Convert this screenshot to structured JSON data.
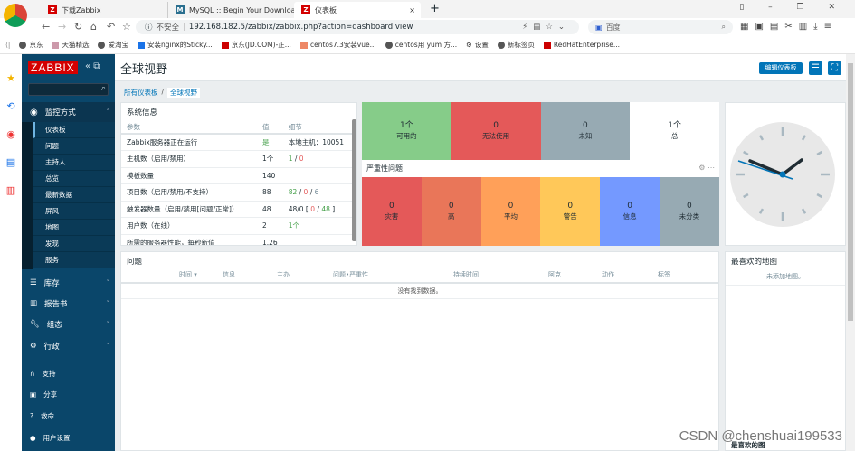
{
  "browser": {
    "tabs": [
      {
        "label": "下载Zabbix"
      },
      {
        "label": "MySQL :: Begin Your Download"
      },
      {
        "label": "仪表板",
        "active": true
      }
    ],
    "security": "不安全",
    "url": "192.168.182.5/zabbix/zabbix.php?action=dashboard.view",
    "search_placeholder": "百度",
    "bookmarks": [
      "京东",
      "天猫精选",
      "爱淘宝",
      "安装nginx的Sticky...",
      "京东(JD.COM)-正...",
      "centos7.3安装vue...",
      "centos用 yum 方...",
      "设置",
      "新标签页",
      "RedHatEnterprise..."
    ]
  },
  "sidebar": {
    "logo": "ZABBIX",
    "monitoring": {
      "label": "监控方式",
      "items": [
        "仪表板",
        "问题",
        "主持人",
        "总览",
        "最新数据",
        "屏风",
        "地图",
        "发现",
        "服务"
      ]
    },
    "sections": [
      "库存",
      "报告书",
      "组态",
      "行政"
    ],
    "footer": [
      "支持",
      "分享",
      "救命",
      "用户设置"
    ]
  },
  "header": {
    "title": "全球视野",
    "edit_button": "编辑仪表板"
  },
  "breadcrumb": [
    "所有仪表板",
    "全球视野"
  ],
  "system_info": {
    "title": "系统信息",
    "columns": [
      "参数",
      "值",
      "细节"
    ],
    "rows": [
      {
        "param": "Zabbix服务器正在运行",
        "value": "是",
        "detail": "本地主机：10051"
      },
      {
        "param": "主机数（启用/禁用）",
        "value": "1个",
        "detail_parts": [
          "1",
          "0"
        ]
      },
      {
        "param": "模板数量",
        "value": "140",
        "detail": ""
      },
      {
        "param": "项目数（启用/禁用/不支持）",
        "value": "88",
        "detail_parts": [
          "82",
          "0",
          "6"
        ]
      },
      {
        "param": "触发器数量（启用/禁用[问题/正常]）",
        "value": "48",
        "detail_parts": [
          "48/0 [",
          "0",
          "48"
        ]
      },
      {
        "param": "用户数（在线）",
        "value": "2",
        "detail": "1个"
      },
      {
        "param": "所需的服务器性能，每秒新值",
        "value": "1.26",
        "detail": ""
      }
    ]
  },
  "host_availability": [
    {
      "count": "1个",
      "label": "可用的",
      "color": "#86cc89"
    },
    {
      "count": "0",
      "label": "无法使用",
      "color": "#e45959"
    },
    {
      "count": "0",
      "label": "未知",
      "color": "#97aab3"
    },
    {
      "count": "1个",
      "label": "总",
      "color": "#ffffff"
    }
  ],
  "severity": {
    "title": "严重性问题",
    "items": [
      {
        "count": "0",
        "label": "灾害",
        "color": "#e45959"
      },
      {
        "count": "0",
        "label": "高",
        "color": "#e97659"
      },
      {
        "count": "0",
        "label": "平均",
        "color": "#ffa059"
      },
      {
        "count": "0",
        "label": "警告",
        "color": "#ffc859"
      },
      {
        "count": "0",
        "label": "信息",
        "color": "#7499ff"
      },
      {
        "count": "0",
        "label": "未分类",
        "color": "#97aab3"
      }
    ]
  },
  "problems": {
    "title": "问题",
    "columns": [
      "时间 ▾",
      "信息",
      "主办",
      "问题•严重性",
      "持续时间",
      "阿克",
      "动作",
      "标签"
    ],
    "empty": "没有找到数据。"
  },
  "fav_maps": {
    "title": "最喜欢的地图",
    "empty": "未添加地图。"
  },
  "fav_graphs": {
    "title": "最喜欢的图"
  },
  "watermark": "CSDN @chenshuai199533"
}
